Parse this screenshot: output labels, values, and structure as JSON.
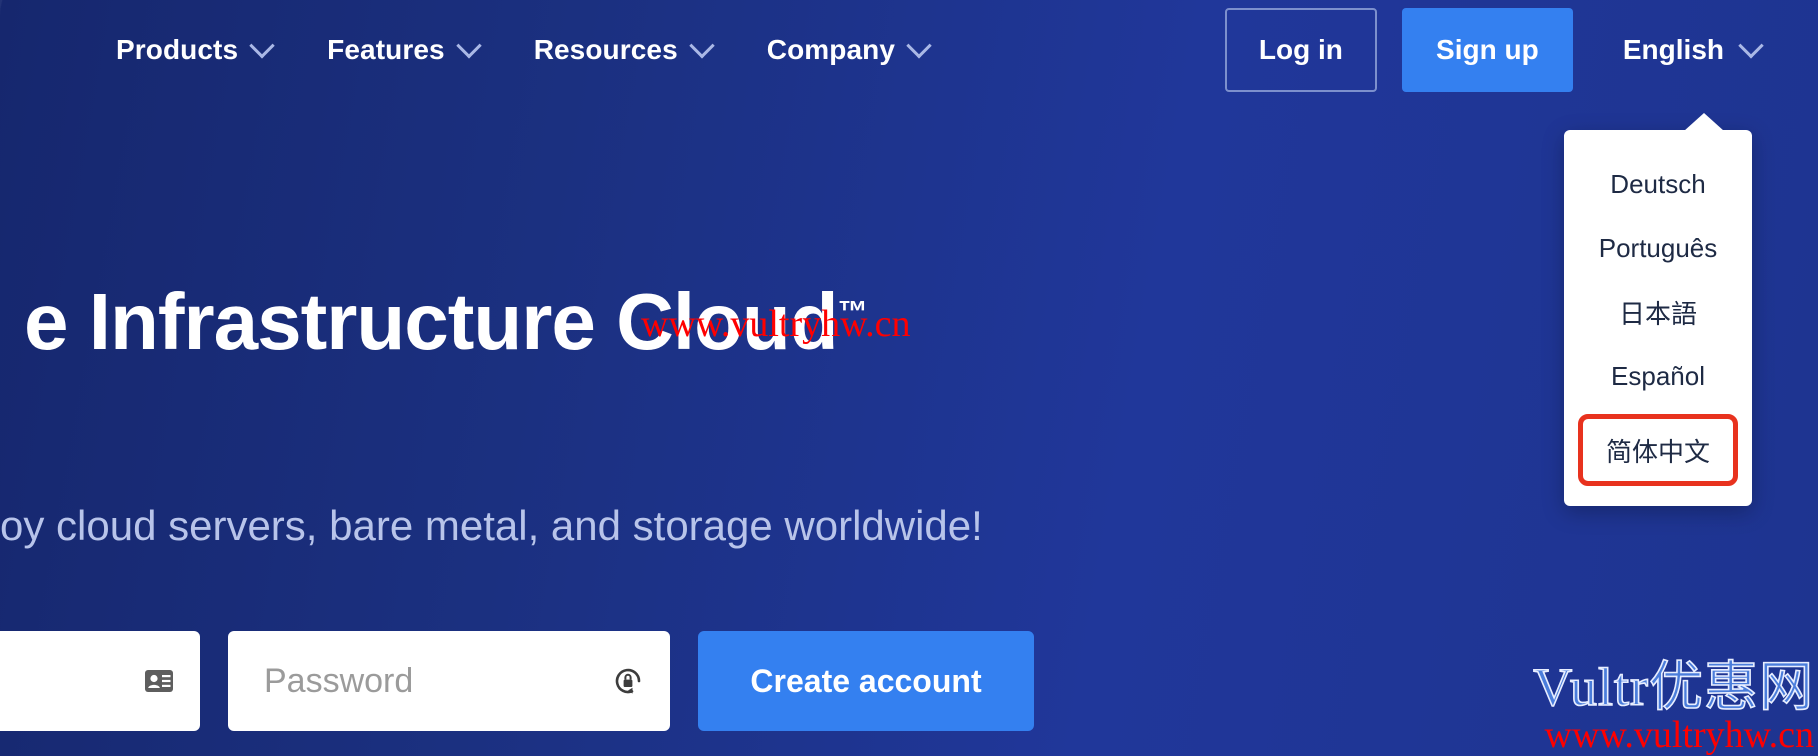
{
  "nav": {
    "items": [
      {
        "label": "Products",
        "icon": "chevron-down-icon"
      },
      {
        "label": "Features",
        "icon": "chevron-down-icon"
      },
      {
        "label": "Resources",
        "icon": "chevron-down-icon"
      },
      {
        "label": "Company",
        "icon": "chevron-down-icon"
      }
    ],
    "login_label": "Log in",
    "signup_label": "Sign up",
    "language_label": "English",
    "language_icon": "chevron-down-icon"
  },
  "language_menu": {
    "options": [
      {
        "label": "Deutsch",
        "highlighted": false
      },
      {
        "label": "Português",
        "highlighted": false
      },
      {
        "label": "日本語",
        "highlighted": false
      },
      {
        "label": "Español",
        "highlighted": false
      },
      {
        "label": "简体中文",
        "highlighted": true
      }
    ],
    "highlight_color": "#e8321e"
  },
  "hero": {
    "title": "e Infrastructure Cloud",
    "title_tm": "™",
    "subtitle": "oy cloud servers, bare metal, and storage worldwide!"
  },
  "signup_form": {
    "email_placeholder": "",
    "email_icon": "contact-card-icon",
    "password_placeholder": "Password",
    "password_icon": "password-lock-icon",
    "create_account_label": "Create account"
  },
  "watermarks": {
    "hero_url": "www.vultryhw.cn",
    "corner_brand": "Vultr优惠网",
    "corner_url": "www.vultryhw.cn"
  },
  "colors": {
    "hero_background": "#1b3080",
    "accent_blue": "#3480f0",
    "text_white": "#ffffff",
    "subtitle_blue": "#b8c4ea",
    "menu_text": "#1e2a44",
    "watermark_red": "#ff0000"
  }
}
